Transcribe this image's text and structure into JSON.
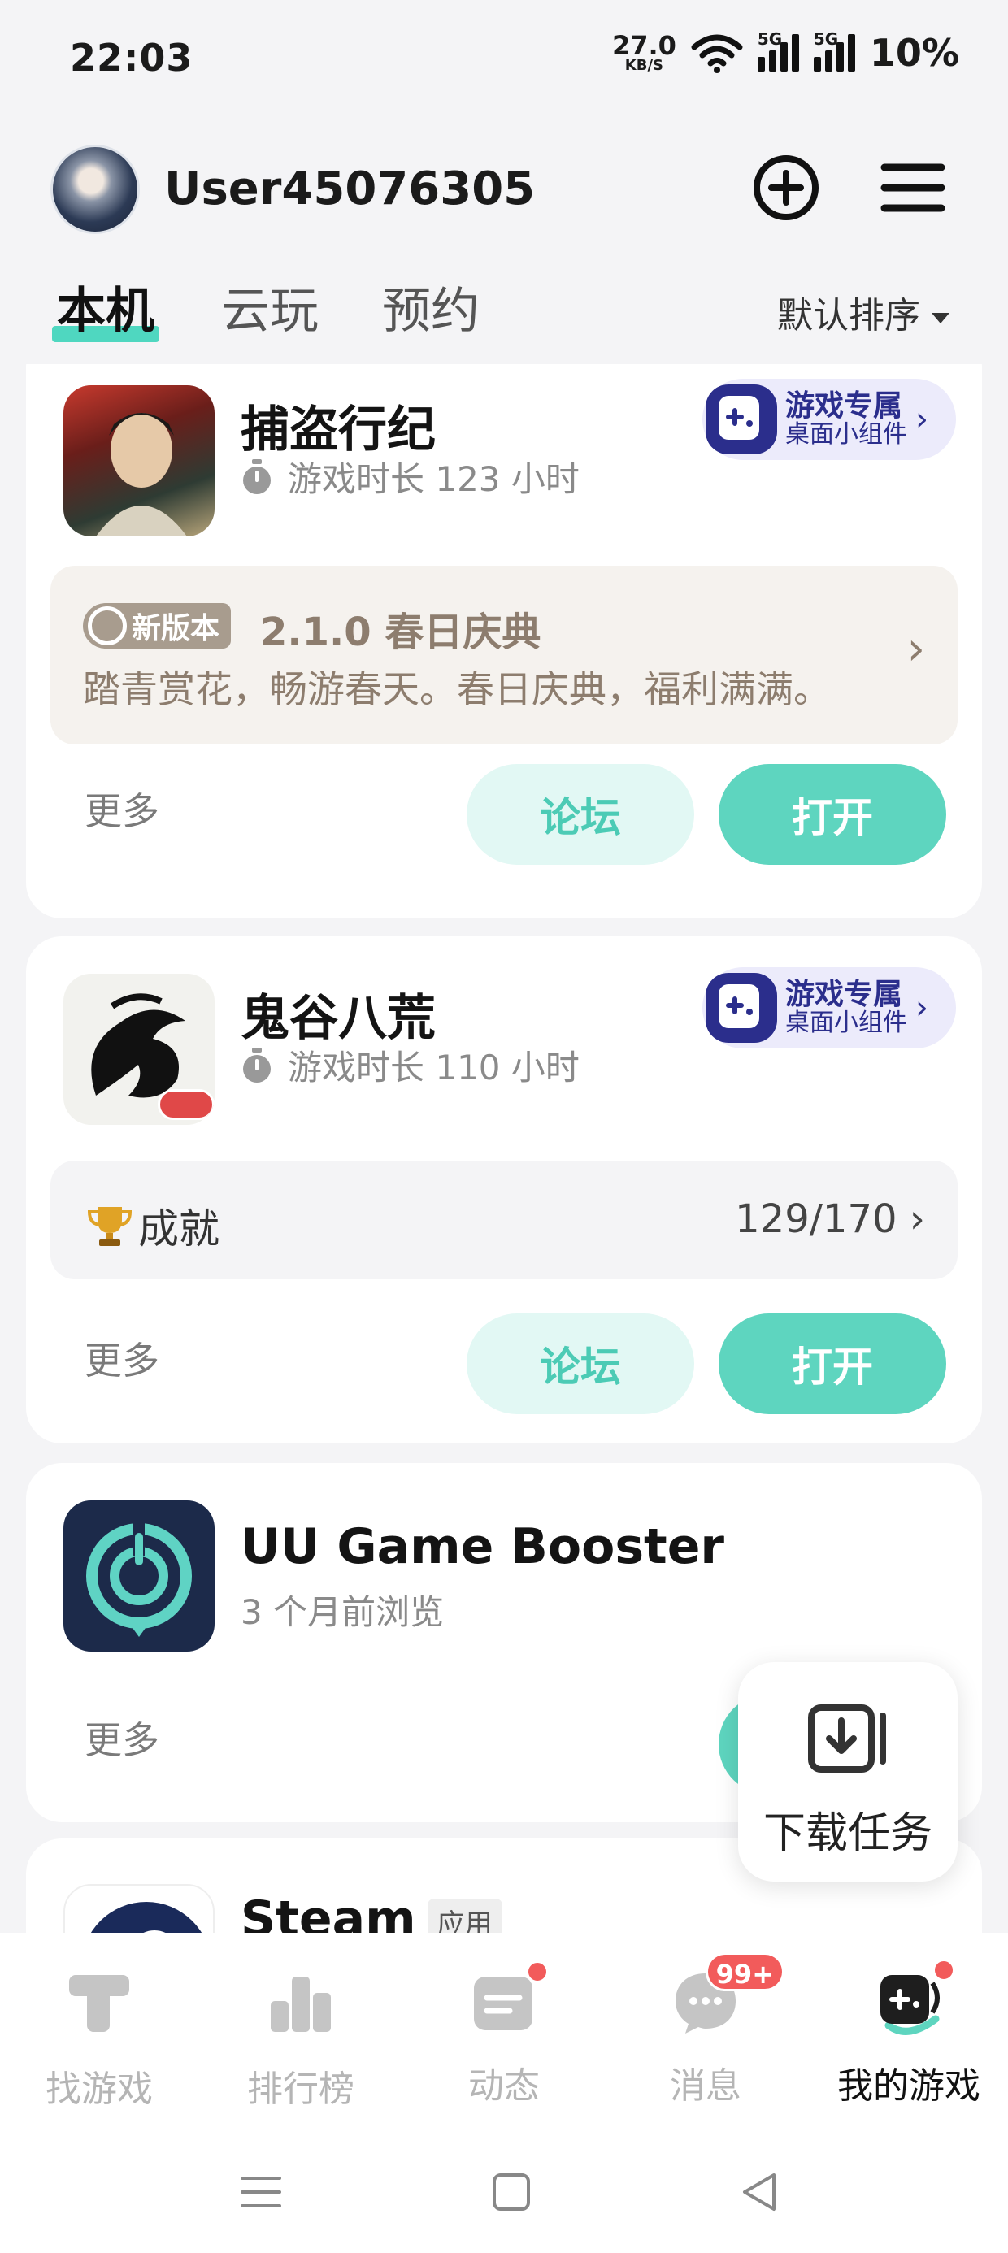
{
  "status_bar": {
    "time": "22:03",
    "net_speed": "27.0",
    "net_unit": "KB/S",
    "net_type1": "5G",
    "net_type2": "5G",
    "battery": "10%"
  },
  "header": {
    "username": "User45076305"
  },
  "tabs": [
    {
      "label": "本机",
      "active": true
    },
    {
      "label": "云玩"
    },
    {
      "label": "预约"
    }
  ],
  "sort": {
    "label": "默认排序"
  },
  "games": [
    {
      "name": "捕盗行纪",
      "playtime": "游戏时长 123 小时",
      "badge": {
        "title": "游戏专属",
        "subtitle": "桌面小组件"
      },
      "news": {
        "tag": "新版本",
        "title": "2.1.0 春日庆典",
        "desc": "踏青赏花，畅游春天。春日庆典，福利满满。"
      },
      "more": "更多",
      "forum": "论坛",
      "open": "打开"
    },
    {
      "name": "鬼谷八荒",
      "playtime": "游戏时长 110 小时",
      "badge": {
        "title": "游戏专属",
        "subtitle": "桌面小组件"
      },
      "achievement": {
        "label": "成就",
        "value": "129/170"
      },
      "more": "更多",
      "forum": "论坛",
      "open": "打开"
    },
    {
      "name": "UU Game Booster",
      "meta": "3 个月前浏览",
      "more": "更多"
    },
    {
      "name": "Steam",
      "tag": "应用"
    }
  ],
  "download": {
    "label": "下载任务"
  },
  "nav": [
    {
      "label": "找游戏",
      "icon": "find-game-icon"
    },
    {
      "label": "排行榜",
      "icon": "ranking-icon"
    },
    {
      "label": "动态",
      "icon": "feed-icon"
    },
    {
      "label": "消息",
      "icon": "message-icon",
      "badge": "99+"
    },
    {
      "label": "我的游戏",
      "icon": "my-games-icon",
      "active": true
    }
  ],
  "colors": {
    "accent": "#5ed5bf",
    "badge_red": "#f25b5b",
    "badge_purple": "#2b2e8c"
  }
}
